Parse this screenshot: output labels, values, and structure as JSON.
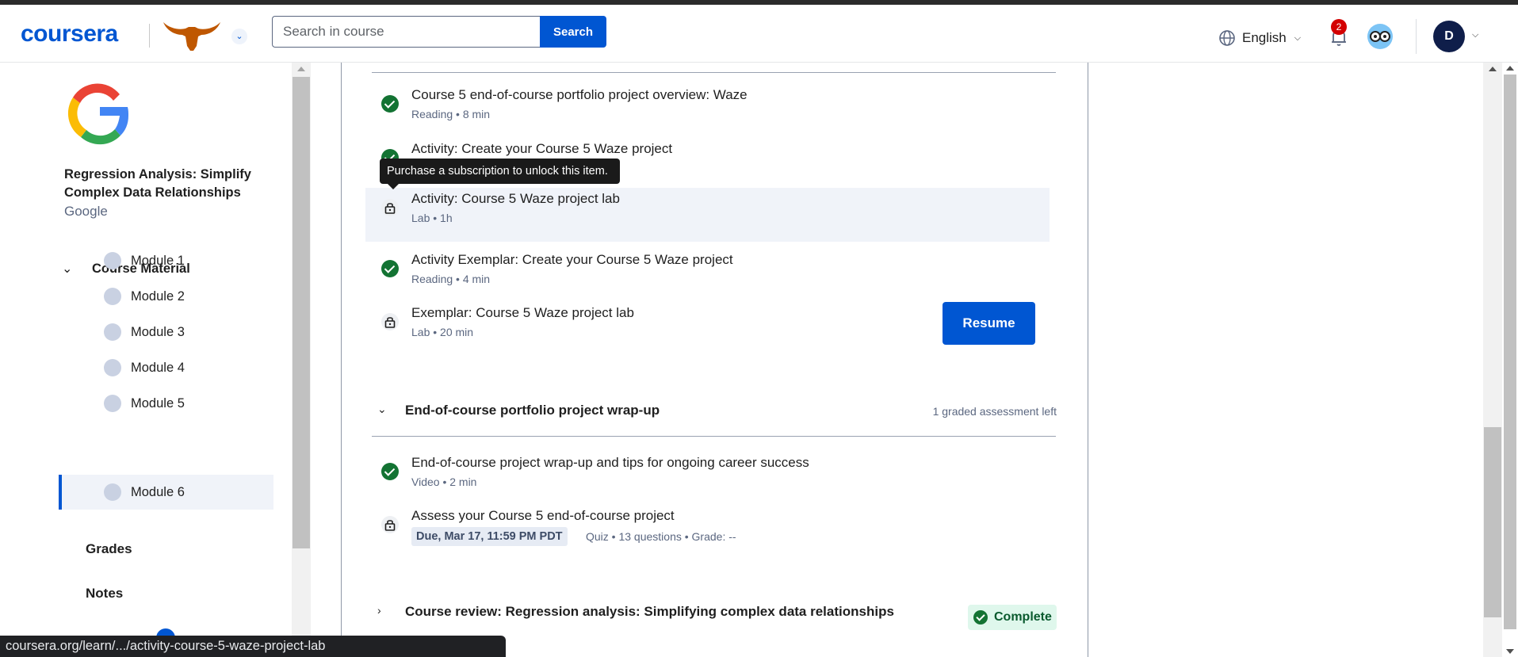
{
  "header": {
    "logo": "coursera",
    "search_placeholder": "Search in course",
    "search_button": "Search",
    "language": "English",
    "notification_count": "2",
    "avatar_initial": "D"
  },
  "sidebar": {
    "course_title": "Regression Analysis: Simplify Complex Data Relationships",
    "partner": "Google",
    "course_material_label": "Course Material",
    "modules": [
      {
        "label": "Module 1"
      },
      {
        "label": "Module 2"
      },
      {
        "label": "Module 3"
      },
      {
        "label": "Module 4"
      },
      {
        "label": "Module 5"
      },
      {
        "label": "Module 6",
        "active": true
      }
    ],
    "grades_label": "Grades",
    "notes_label": "Notes"
  },
  "main": {
    "items": [
      {
        "title": "Course 5 end-of-course portfolio project overview: Waze",
        "meta": "Reading • 8 min",
        "status": "done"
      },
      {
        "title": "Activity: Create your Course 5 Waze project",
        "meta": "",
        "status": "done"
      },
      {
        "title": "Activity: Course 5 Waze project lab",
        "meta": "Lab • 1h",
        "status": "locked"
      },
      {
        "title": "Activity Exemplar: Create your Course 5 Waze project",
        "meta": "Reading • 4 min",
        "status": "done"
      },
      {
        "title": "Exemplar: Course 5 Waze project lab",
        "meta": "Lab • 20 min",
        "status": "locked"
      }
    ],
    "tooltip": "Purchase a subscription to unlock this item.",
    "resume_button": "Resume",
    "section_wrapup": {
      "title": "End-of-course portfolio project wrap-up",
      "right_text": "1 graded assessment left",
      "items": [
        {
          "title": "End-of-course project wrap-up and tips for ongoing career success",
          "meta": "Video • 2 min",
          "status": "done"
        },
        {
          "title": "Assess your Course 5 end-of-course project",
          "due": "Due, Mar 17, 11:59 PM PDT",
          "meta": "Quiz • 13 questions • Grade: --",
          "status": "locked"
        }
      ]
    },
    "section_review": {
      "title": "Course review: Regression analysis: Simplifying complex data relationships",
      "badge": "Complete"
    }
  },
  "status_bar_url": "coursera.org/learn/.../activity-course-5-waze-project-lab",
  "colors": {
    "brand": "#0056d2",
    "done": "#137333",
    "badge": "#d30001"
  }
}
